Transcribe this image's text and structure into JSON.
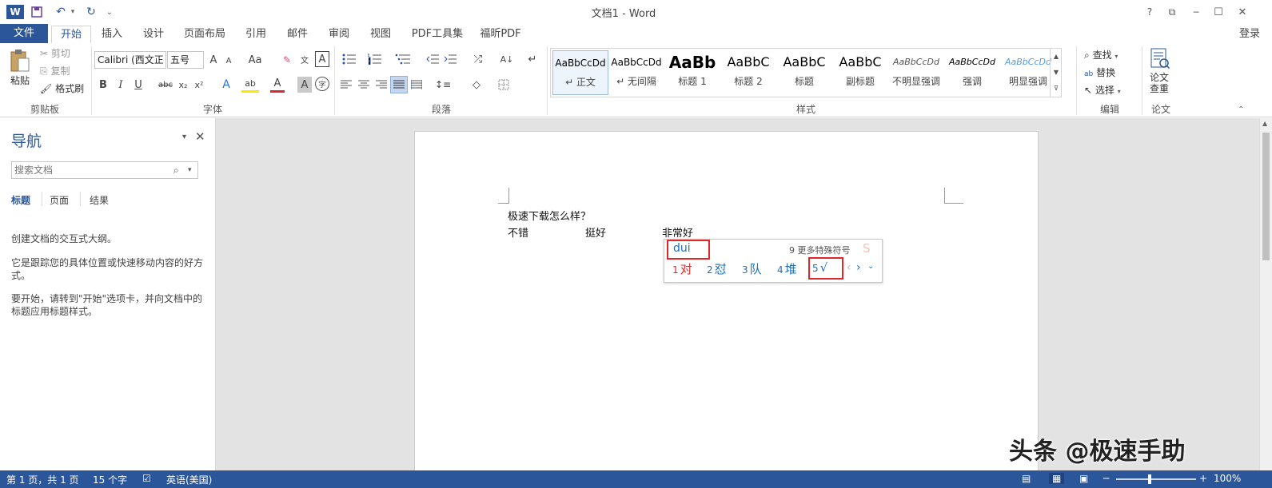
{
  "app": {
    "window_title": "文档1 - Word"
  },
  "titlebar": {
    "help": "?",
    "restore_ribbon": "⧉",
    "minimize": "─",
    "maximize": "☐",
    "close": "✕",
    "word_logo": "W",
    "save": "💾",
    "undo": "↶",
    "redo": "↻",
    "customize": "⌄"
  },
  "tabs": {
    "file": "文件",
    "home": "开始",
    "insert": "插入",
    "design": "设计",
    "layout": "页面布局",
    "references": "引用",
    "mailings": "邮件",
    "review": "审阅",
    "view": "视图",
    "pdf_tools": "PDF工具集",
    "foxit_pdf": "福昕PDF",
    "login": "登录"
  },
  "clipboard": {
    "paste": "粘贴",
    "cut": "剪切",
    "copy": "复制",
    "format_painter": "格式刷",
    "group_label": "剪贴板"
  },
  "font": {
    "font_name": "Calibri (西文正",
    "font_size": "五号",
    "grow": "A",
    "shrink": "A",
    "case": "Aa",
    "clear": "✎",
    "phonetic": "文",
    "border_char": "A",
    "bold": "B",
    "italic": "I",
    "underline": "U",
    "strike": "abc",
    "subscript": "x₂",
    "superscript": "x²",
    "text_effects": "A",
    "highlight": "ab",
    "font_color": "A",
    "char_shading": "A",
    "enclose": "字",
    "group_label": "字体"
  },
  "paragraph": {
    "group_label": "段落"
  },
  "styles": {
    "items": [
      {
        "sample": "AaBbCcDd",
        "name": "↵ 正文"
      },
      {
        "sample": "AaBbCcDd",
        "name": "↵ 无间隔"
      },
      {
        "sample": "AaBb",
        "name": "标题 1"
      },
      {
        "sample": "AaBbC",
        "name": "标题 2"
      },
      {
        "sample": "AaBbC",
        "name": "标题"
      },
      {
        "sample": "AaBbC",
        "name": "副标题"
      },
      {
        "sample": "AaBbCcDd",
        "name": "不明显强调"
      },
      {
        "sample": "AaBbCcDd",
        "name": "强调"
      },
      {
        "sample": "AaBbCcDd",
        "name": "明显强调"
      }
    ],
    "group_label": "样式"
  },
  "editing": {
    "find": "查找",
    "replace": "替换",
    "select": "选择",
    "group_label": "编辑"
  },
  "paper": {
    "check": "论文\n查重",
    "group_label": "论文"
  },
  "nav": {
    "title": "导航",
    "search_placeholder": "搜索文档",
    "tabs": [
      "标题",
      "页面",
      "结果"
    ],
    "text1": "创建文档的交互式大纲。",
    "text2": "它是跟踪您的具体位置或快速移动内容的好方式。",
    "text3": "要开始，请转到\"开始\"选项卡，并向文档中的标题应用标题样式。"
  },
  "document": {
    "line1": "极速下载怎么样？",
    "word1": "不错",
    "word2": "挺好",
    "word3": "非常好"
  },
  "ime": {
    "input": "dui",
    "more_symbols": "9 更多特殊符号",
    "candidates": [
      {
        "n": "1",
        "text": "对"
      },
      {
        "n": "2",
        "text": "怼"
      },
      {
        "n": "3",
        "text": "队"
      },
      {
        "n": "4",
        "text": "堆"
      },
      {
        "n": "5",
        "text": "√"
      }
    ]
  },
  "status": {
    "page": "第 1 页，共 1 页",
    "words": "15 个字",
    "language": "英语(美国)",
    "zoom": "100%"
  },
  "watermark": {
    "text": "头条 @极速手助"
  },
  "colors": {
    "accent": "#2b579a",
    "highlight": "#e0282a",
    "ime_blue": "#1a6fc2"
  }
}
